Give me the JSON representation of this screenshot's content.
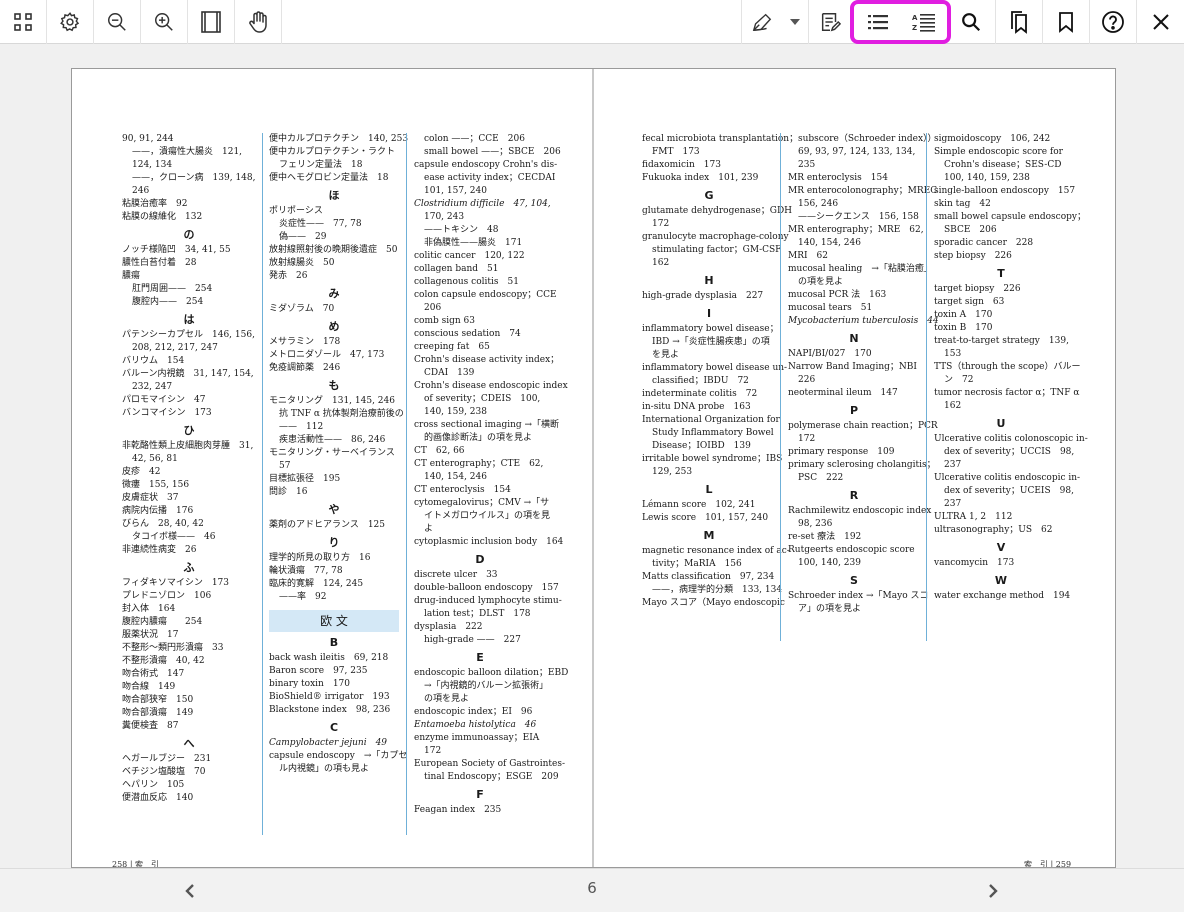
{
  "toolbar": {
    "accent": "#e01ee0",
    "icons": [
      "grid-icon",
      "gear-icon",
      "zoom-out-icon",
      "zoom-in-icon",
      "fit-page-icon",
      "hand-icon",
      "pen-icon",
      "chevron-down-icon",
      "note-icon",
      "list-icon",
      "sort-list-icon",
      "search-icon",
      "bookmarks-icon",
      "bookmark-icon",
      "help-icon",
      "close-icon"
    ]
  },
  "footer": {
    "page_number": "6",
    "prev": "‹",
    "next": "›"
  },
  "left_page": {
    "footer": "258 | 索　引",
    "col1": [
      {
        "t": "90, 91, 244"
      },
      {
        "t": "——，潰瘍性大腸炎　121,",
        "c": "ind"
      },
      {
        "t": "124, 134",
        "c": "ind"
      },
      {
        "t": "——，クローン病　139, 148,",
        "c": "ind"
      },
      {
        "t": "246",
        "c": "ind"
      },
      {
        "t": "粘膜治癒率　92"
      },
      {
        "t": "粘膜の線維化　132"
      },
      {
        "t": "の",
        "c": "hd"
      },
      {
        "t": "ノッチ様陥凹　34, 41, 55"
      },
      {
        "t": "膿性白苔付着　28"
      },
      {
        "t": "膿瘍"
      },
      {
        "t": "肛門周囲——　254",
        "c": "ind"
      },
      {
        "t": "腹腔内——　254",
        "c": "ind"
      },
      {
        "t": "は",
        "c": "hd"
      },
      {
        "t": "パテンシーカプセル　146, 156,"
      },
      {
        "t": "208, 212, 217, 247",
        "c": "ind"
      },
      {
        "t": "バリウム　154"
      },
      {
        "t": "バルーン内視鏡　31, 147, 154,"
      },
      {
        "t": "232, 247",
        "c": "ind"
      },
      {
        "t": "パロモマイシン　47"
      },
      {
        "t": "バンコマイシン　173"
      },
      {
        "t": "ひ",
        "c": "hd"
      },
      {
        "t": "非乾酪性類上皮細胞肉芽腫　31,"
      },
      {
        "t": "42, 56, 81",
        "c": "ind"
      },
      {
        "t": "皮疹　42"
      },
      {
        "t": "微瘻　155, 156"
      },
      {
        "t": "皮膚症状　37"
      },
      {
        "t": "病院内伝播　176"
      },
      {
        "t": "びらん　28, 40, 42"
      },
      {
        "t": "タコイボ様——　46",
        "c": "ind"
      },
      {
        "t": "非連続性病変　26"
      },
      {
        "t": "ふ",
        "c": "hd"
      },
      {
        "t": "フィダキソマイシン　173"
      },
      {
        "t": "プレドニゾロン　106"
      },
      {
        "t": "封入体　164"
      },
      {
        "t": "腹腔内膿瘍　　254"
      },
      {
        "t": "服薬状況　17"
      },
      {
        "t": "不整形～類円形潰瘍　33"
      },
      {
        "t": "不整形潰瘍　40, 42"
      },
      {
        "t": "吻合術式　147"
      },
      {
        "t": "吻合線　149"
      },
      {
        "t": "吻合部狭窄　150"
      },
      {
        "t": "吻合部潰瘍　149"
      },
      {
        "t": "糞便検査　87"
      },
      {
        "t": "へ",
        "c": "hd"
      },
      {
        "t": "ヘガールブジー　231"
      },
      {
        "t": "ベチジン塩酸塩　70"
      },
      {
        "t": "ヘパリン　105"
      },
      {
        "t": "便潜血反応　140"
      }
    ],
    "col2": [
      {
        "t": "便中カルプロテクチン　140, 253"
      },
      {
        "t": "便中カルプロテクチン・ラクト"
      },
      {
        "t": "フェリン定量法　18",
        "c": "ind"
      },
      {
        "t": "便中ヘモグロビン定量法　18"
      },
      {
        "t": "ほ",
        "c": "hd"
      },
      {
        "t": "ポリポーシス"
      },
      {
        "t": "炎症性——　77, 78",
        "c": "ind"
      },
      {
        "t": "偽——　29",
        "c": "ind"
      },
      {
        "t": "放射線照射後の晩期後遺症　50"
      },
      {
        "t": "放射線腸炎　50"
      },
      {
        "t": "発赤　26"
      },
      {
        "t": "み",
        "c": "hd"
      },
      {
        "t": "ミダゾラム　70"
      },
      {
        "t": "め",
        "c": "hd"
      },
      {
        "t": "メサラミン　178"
      },
      {
        "t": "メトロニダゾール　47, 173"
      },
      {
        "t": "免疫調節薬　246"
      },
      {
        "t": "も",
        "c": "hd"
      },
      {
        "t": "モニタリング　131, 145, 246"
      },
      {
        "t": "抗 TNF α 抗体製剤治療前後の",
        "c": "ind"
      },
      {
        "t": "——　112",
        "c": "ind"
      },
      {
        "t": "疾患活動性——　86, 246",
        "c": "ind"
      },
      {
        "t": "モニタリング・サーベイランス"
      },
      {
        "t": "57",
        "c": "ind"
      },
      {
        "t": "目標拡張径　195"
      },
      {
        "t": "問診　16"
      },
      {
        "t": "や",
        "c": "hd"
      },
      {
        "t": "薬剤のアドヒアランス　125"
      },
      {
        "t": "り",
        "c": "hd"
      },
      {
        "t": "理学的所見の取り方　16"
      },
      {
        "t": "輪状潰瘍　77, 78"
      },
      {
        "t": "臨床的寛解　124, 245"
      },
      {
        "t": "——率　92",
        "c": "ind"
      },
      {
        "t": "欧 文",
        "c": "band"
      },
      {
        "t": "B",
        "c": "hd"
      },
      {
        "t": "back wash ileitis　69, 218"
      },
      {
        "t": "Baron score　97, 235"
      },
      {
        "t": "binary toxin　170"
      },
      {
        "t": "BioShield® irrigator　193"
      },
      {
        "t": "Blackstone index　98, 236"
      },
      {
        "t": "C",
        "c": "hd"
      },
      {
        "t": "Campylobacter jejuni　49",
        "c": "it"
      },
      {
        "t": "capsule endoscopy　→「カプセ"
      },
      {
        "t": "ル内視鏡」の項も見よ",
        "c": "ind"
      }
    ],
    "col3": [
      {
        "t": "colon ——；CCE　206",
        "c": "ind"
      },
      {
        "t": "small bowel ——；SBCE　206",
        "c": "ind"
      },
      {
        "t": "capsule endoscopy Crohn's dis-"
      },
      {
        "t": "ease activity index；CECDAI",
        "c": "ind"
      },
      {
        "t": "101, 157, 240",
        "c": "ind"
      },
      {
        "t": "Clostridium difficile　47, 104,",
        "c": "it"
      },
      {
        "t": "170, 243",
        "c": "ind"
      },
      {
        "t": "——トキシン　48",
        "c": "ind"
      },
      {
        "t": "非偽膜性——腸炎　171",
        "c": "ind"
      },
      {
        "t": "colitic cancer　120, 122"
      },
      {
        "t": "collagen band　51"
      },
      {
        "t": "collagenous colitis　51"
      },
      {
        "t": "colon capsule endoscopy；CCE"
      },
      {
        "t": "206",
        "c": "ind"
      },
      {
        "t": "comb sign 63"
      },
      {
        "t": "conscious sedation　74"
      },
      {
        "t": "creeping fat　65"
      },
      {
        "t": "Crohn's disease activity index；"
      },
      {
        "t": "CDAI　139",
        "c": "ind"
      },
      {
        "t": "Crohn's disease endoscopic index"
      },
      {
        "t": "of severity；CDEIS　100,",
        "c": "ind"
      },
      {
        "t": "140, 159, 238",
        "c": "ind"
      },
      {
        "t": "cross sectional imaging →「横断"
      },
      {
        "t": "的画像診断法」の項を見よ",
        "c": "ind"
      },
      {
        "t": "CT　62, 66"
      },
      {
        "t": "CT enterography；CTE　62,"
      },
      {
        "t": "140, 154, 246",
        "c": "ind"
      },
      {
        "t": "CT enteroclysis　154"
      },
      {
        "t": "cytomegalovirus；CMV →「サ"
      },
      {
        "t": "イトメガロウイルス」の項を見",
        "c": "ind"
      },
      {
        "t": "よ",
        "c": "ind"
      },
      {
        "t": "cytoplasmic inclusion body　164"
      },
      {
        "t": "D",
        "c": "hd"
      },
      {
        "t": "discrete ulcer　33"
      },
      {
        "t": "double-balloon endoscopy　157"
      },
      {
        "t": "drug-induced lymphocyte stimu-"
      },
      {
        "t": "lation test；DLST　178",
        "c": "ind"
      },
      {
        "t": "dysplasia　222"
      },
      {
        "t": "high-grade ——　227",
        "c": "ind"
      },
      {
        "t": "E",
        "c": "hd"
      },
      {
        "t": "endoscopic balloon dilation；EBD"
      },
      {
        "t": "→「内視鏡的バルーン拡張術」",
        "c": "ind"
      },
      {
        "t": "の項を見よ",
        "c": "ind"
      },
      {
        "t": "endoscopic index；EI　96"
      },
      {
        "t": "Entamoeba histolytica　46",
        "c": "it"
      },
      {
        "t": "enzyme immunoassay；EIA"
      },
      {
        "t": "172",
        "c": "ind"
      },
      {
        "t": "European Society of Gastrointes-"
      },
      {
        "t": "tinal Endoscopy；ESGE　209",
        "c": "ind"
      },
      {
        "t": "F",
        "c": "hd"
      },
      {
        "t": "Feagan index　235"
      }
    ]
  },
  "right_page": {
    "footer": "索　引 | 259",
    "col1": [
      {
        "t": "fecal microbiota transplantation；"
      },
      {
        "t": "FMT　173",
        "c": "ind"
      },
      {
        "t": "fidaxomicin　173"
      },
      {
        "t": "Fukuoka index　101, 239"
      },
      {
        "t": "G",
        "c": "hd"
      },
      {
        "t": "glutamate dehydrogenase；GDH"
      },
      {
        "t": "172",
        "c": "ind"
      },
      {
        "t": "granulocyte macrophage-colony"
      },
      {
        "t": "stimulating factor；GM-CSF",
        "c": "ind"
      },
      {
        "t": "162",
        "c": "ind"
      },
      {
        "t": "H",
        "c": "hd"
      },
      {
        "t": "high-grade dysplasia　227"
      },
      {
        "t": "I",
        "c": "hd"
      },
      {
        "t": "inflammatory bowel disease；"
      },
      {
        "t": "IBD →「炎症性腸疾患」の項",
        "c": "ind"
      },
      {
        "t": "を見よ",
        "c": "ind"
      },
      {
        "t": "inflammatory bowel disease un-"
      },
      {
        "t": "classified；IBDU　72",
        "c": "ind"
      },
      {
        "t": "indeterminate colitis　72"
      },
      {
        "t": "in-situ DNA probe　163"
      },
      {
        "t": "International Organization for"
      },
      {
        "t": "Study Inflammatory Bowel",
        "c": "ind"
      },
      {
        "t": "Disease；IOIBD　139",
        "c": "ind"
      },
      {
        "t": "irritable bowel syndrome；IBS"
      },
      {
        "t": "129, 253",
        "c": "ind"
      },
      {
        "t": "L",
        "c": "hd"
      },
      {
        "t": "Lémann score　102, 241"
      },
      {
        "t": "Lewis score　101, 157, 240"
      },
      {
        "t": "M",
        "c": "hd"
      },
      {
        "t": "magnetic resonance index of ac-"
      },
      {
        "t": "tivity；MaRIA　156",
        "c": "ind"
      },
      {
        "t": "Matts classification　97, 234"
      },
      {
        "t": "——，病理学的分類　133, 134",
        "c": "ind"
      },
      {
        "t": "Mayo スコア（Mayo endoscopic"
      }
    ],
    "col2": [
      {
        "t": "subscore（Schroeder index））",
        "c": "ind"
      },
      {
        "t": "69, 93, 97, 124, 133, 134,",
        "c": "ind"
      },
      {
        "t": "235",
        "c": "ind"
      },
      {
        "t": "MR enteroclysis　154"
      },
      {
        "t": "MR enterocolonography；MREC"
      },
      {
        "t": "156, 246",
        "c": "ind"
      },
      {
        "t": "——シークエンス　156, 158",
        "c": "ind"
      },
      {
        "t": "MR enterography；MRE　62,"
      },
      {
        "t": "140, 154, 246",
        "c": "ind"
      },
      {
        "t": "MRI　62"
      },
      {
        "t": "mucosal healing　→「粘膜治癒」"
      },
      {
        "t": "の項を見よ",
        "c": "ind"
      },
      {
        "t": "mucosal PCR 法　163"
      },
      {
        "t": "mucosal tears　51"
      },
      {
        "t": "Mycobacterium tuberculosis　44",
        "c": "it"
      },
      {
        "t": "N",
        "c": "hd"
      },
      {
        "t": "NAPI/BI/027　170"
      },
      {
        "t": "Narrow Band Imaging；NBI"
      },
      {
        "t": "226",
        "c": "ind"
      },
      {
        "t": "neoterminal ileum　147"
      },
      {
        "t": "P",
        "c": "hd"
      },
      {
        "t": "polymerase chain reaction；PCR"
      },
      {
        "t": "172",
        "c": "ind"
      },
      {
        "t": "primary response　109"
      },
      {
        "t": "primary sclerosing cholangitis；"
      },
      {
        "t": "PSC　222",
        "c": "ind"
      },
      {
        "t": "R",
        "c": "hd"
      },
      {
        "t": "Rachmilewitz endoscopic index"
      },
      {
        "t": "98, 236",
        "c": "ind"
      },
      {
        "t": "re-set 療法　192"
      },
      {
        "t": "Rutgeerts endoscopic score"
      },
      {
        "t": "100, 140, 239",
        "c": "ind"
      },
      {
        "t": "S",
        "c": "hd"
      },
      {
        "t": "Schroeder index →「Mayo スコ"
      },
      {
        "t": "ア」の項を見よ",
        "c": "ind"
      }
    ],
    "col3": [
      {
        "t": "sigmoidoscopy　106, 242"
      },
      {
        "t": "Simple endoscopic score for"
      },
      {
        "t": "Crohn's disease；SES-CD",
        "c": "ind"
      },
      {
        "t": "100, 140, 159, 238",
        "c": "ind"
      },
      {
        "t": "single-balloon endoscopy　157"
      },
      {
        "t": "skin tag　42"
      },
      {
        "t": "small bowel capsule endoscopy；"
      },
      {
        "t": "SBCE　206",
        "c": "ind"
      },
      {
        "t": "sporadic cancer　228"
      },
      {
        "t": "step biopsy　226"
      },
      {
        "t": "T",
        "c": "hd"
      },
      {
        "t": "target biopsy　226"
      },
      {
        "t": "target sign　63"
      },
      {
        "t": "toxin A　170"
      },
      {
        "t": "toxin B　170"
      },
      {
        "t": "treat-to-target strategy　139,"
      },
      {
        "t": "153",
        "c": "ind"
      },
      {
        "t": "TTS（through the scope）バルー"
      },
      {
        "t": "ン　72",
        "c": "ind"
      },
      {
        "t": "tumor necrosis factor α；TNF α"
      },
      {
        "t": "162",
        "c": "ind"
      },
      {
        "t": "U",
        "c": "hd"
      },
      {
        "t": "Ulcerative colitis colonoscopic in-"
      },
      {
        "t": "dex of severity；UCCIS　98,",
        "c": "ind"
      },
      {
        "t": "237",
        "c": "ind"
      },
      {
        "t": "Ulcerative colitis endoscopic in-"
      },
      {
        "t": "dex of severity；UCEIS　98,",
        "c": "ind"
      },
      {
        "t": "237",
        "c": "ind"
      },
      {
        "t": "ULTRA 1, 2　112"
      },
      {
        "t": "ultrasonography；US　62"
      },
      {
        "t": "V",
        "c": "hd"
      },
      {
        "t": "vancomycin　173"
      },
      {
        "t": "W",
        "c": "hd"
      },
      {
        "t": "water exchange method　194"
      }
    ]
  }
}
